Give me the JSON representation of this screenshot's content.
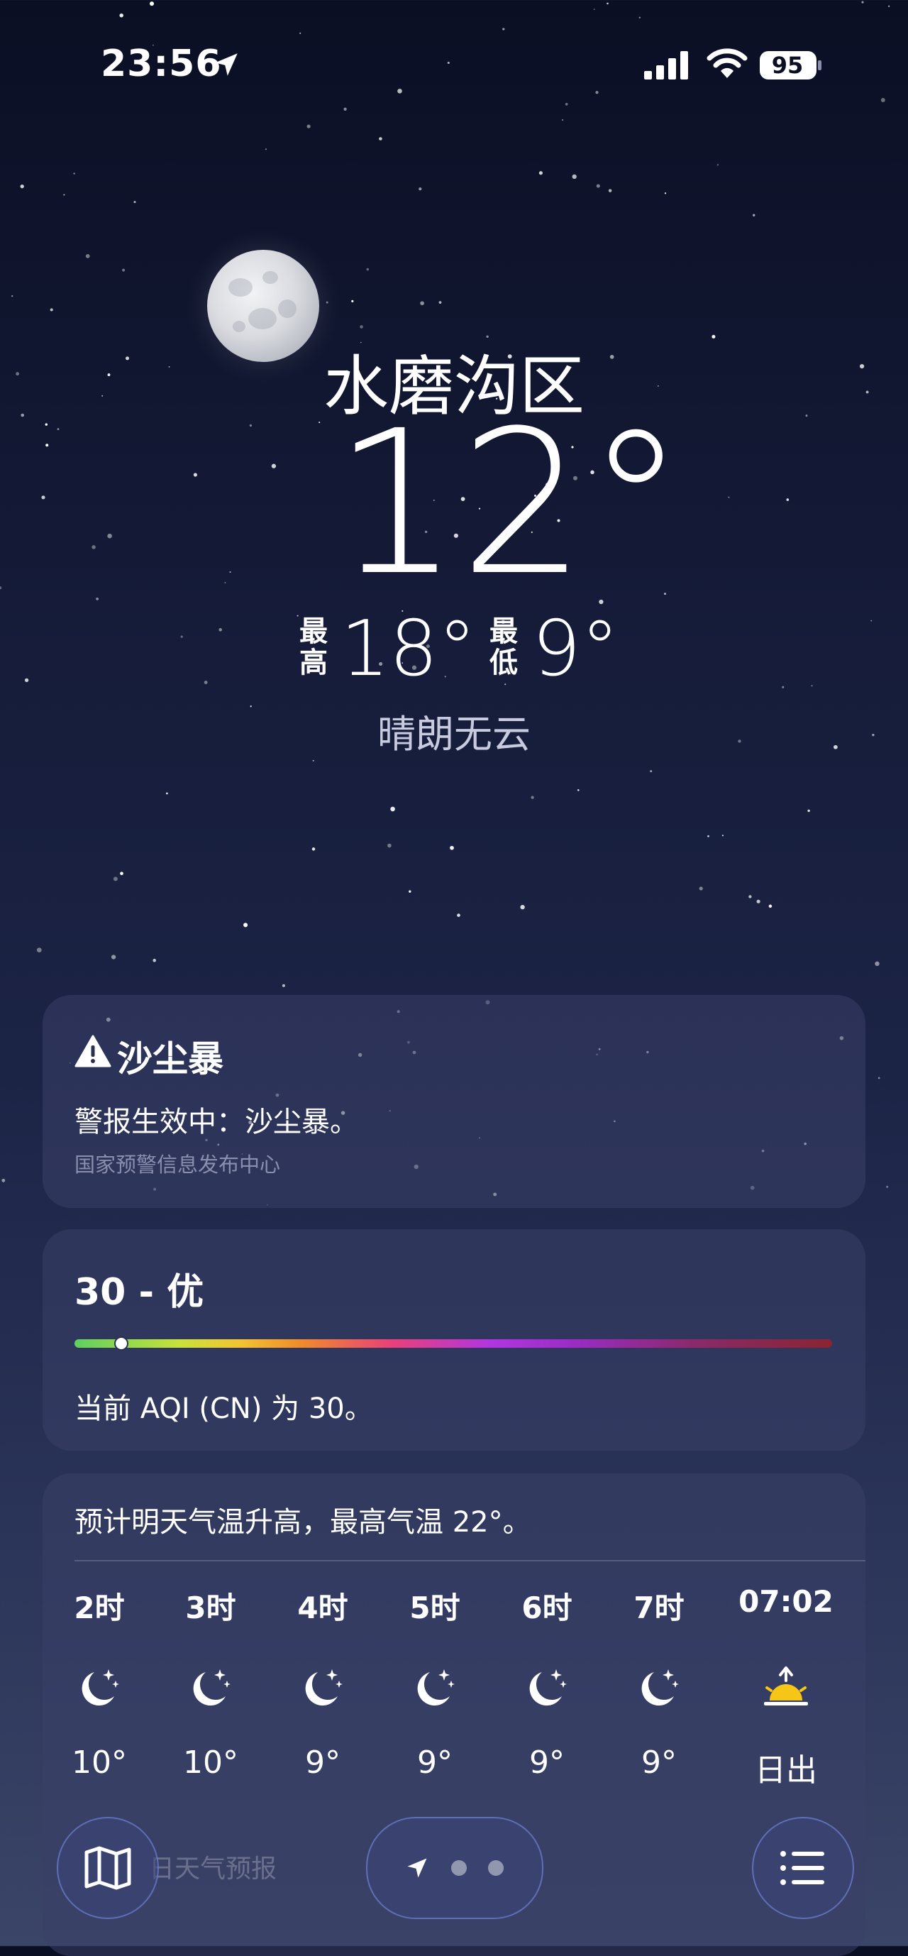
{
  "status_bar": {
    "time": "23:56",
    "battery": "95"
  },
  "header": {
    "city": "水磨沟区",
    "temperature": "12°",
    "high_label_1": "最",
    "high_label_2": "高",
    "high": "18°",
    "low_label_1": "最",
    "low_label_2": "低",
    "low": "9°",
    "condition": "晴朗无云"
  },
  "alert": {
    "title": "沙尘暴",
    "body": "警报生效中：沙尘暴。",
    "source": "国家预警信息发布中心"
  },
  "aqi": {
    "title": "30 - 优",
    "value_fraction": 0.06,
    "description": "当前 AQI (CN) 为 30。"
  },
  "hourly": {
    "note": "预计明天气温升高，最高气温 22°。",
    "items": [
      {
        "time": "2时",
        "icon": "moon-stars-icon",
        "temp": "10°"
      },
      {
        "time": "3时",
        "icon": "moon-stars-icon",
        "temp": "10°"
      },
      {
        "time": "4时",
        "icon": "moon-stars-icon",
        "temp": "9°"
      },
      {
        "time": "5时",
        "icon": "moon-stars-icon",
        "temp": "9°"
      },
      {
        "time": "6时",
        "icon": "moon-stars-icon",
        "temp": "9°"
      },
      {
        "time": "7时",
        "icon": "moon-stars-icon",
        "temp": "9°"
      },
      {
        "time": "07:02",
        "icon": "sunrise-icon",
        "temp": "日出"
      }
    ]
  },
  "bottom": {
    "daily_label_partial": "日天气预报"
  },
  "colors": {
    "sky_top": "#0b0f24",
    "sky_bottom": "#3a4568",
    "card": "#3a4068",
    "sunrise": "#f5c518"
  }
}
